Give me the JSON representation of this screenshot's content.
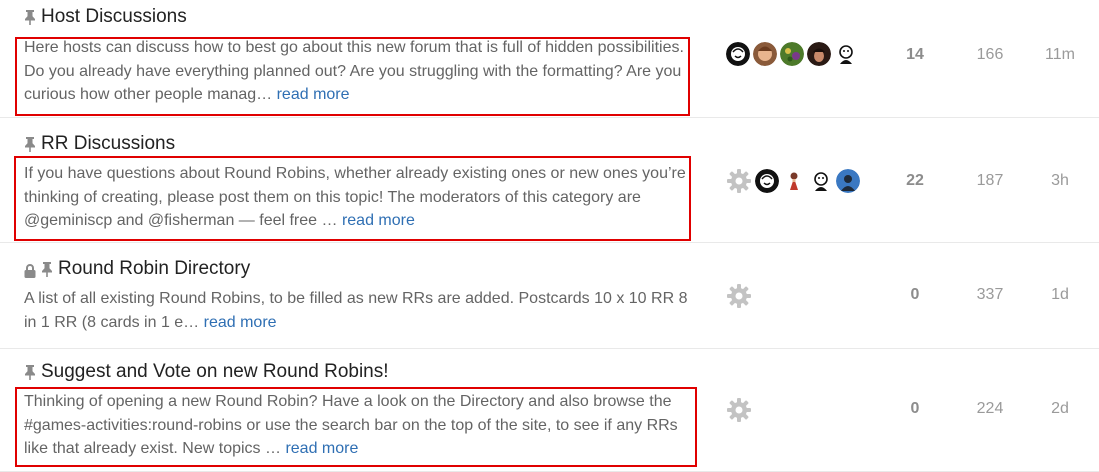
{
  "topics": [
    {
      "title": "Host Discussions",
      "excerpt": "Here hosts can discuss how to best go about this new forum that is full of hidden possibilities. Do you already have everything planned out? Are you struggling with the formatting? Are you curious how other people manag…",
      "read_more": "read more",
      "posters": [
        "bw-sketch-avatar",
        "woman-photo-avatar",
        "garden-avatar",
        "dark-hair-avatar",
        "cartoon-avatar"
      ],
      "replies": "14",
      "views": "166",
      "activity": "11m",
      "pinned": true,
      "locked": false,
      "highlighted": true
    },
    {
      "title": "RR Discussions",
      "excerpt": "If you have questions about Round Robins, whether already existing ones or new ones you’re thinking of creating, please post them on this topic! The moderators of this category are @geminiscp and @fisherman — feel free …",
      "read_more": "read more",
      "posters": [
        "gear-avatar",
        "bw-sketch-avatar",
        "doll-avatar",
        "cartoon-avatar",
        "blue-photo-avatar"
      ],
      "replies": "22",
      "views": "187",
      "activity": "3h",
      "pinned": true,
      "locked": false,
      "highlighted": true
    },
    {
      "title": "Round Robin Directory",
      "excerpt": "A list of all existing Round Robins, to be filled as new RRs are added. Postcards 10 x 10 RR 8 in 1 RR (8 cards in 1 e…",
      "read_more": "read more",
      "posters": [
        "gear-avatar"
      ],
      "replies": "0",
      "views": "337",
      "activity": "1d",
      "pinned": true,
      "locked": true,
      "highlighted": false
    },
    {
      "title": "Suggest and Vote on new Round Robins!",
      "excerpt": "Thinking of opening a new Round Robin? Have a look on the Directory and also browse the #games-activities:round-robins or use the search bar on the top of the site, to see if any RRs like that already exist. New topics …",
      "read_more": "read more",
      "posters": [
        "gear-avatar"
      ],
      "replies": "0",
      "views": "224",
      "activity": "2d",
      "pinned": true,
      "locked": false,
      "highlighted": true
    }
  ],
  "colors": {
    "highlight": "#e00000",
    "link": "#2f6fb3",
    "excerpt": "#646464"
  }
}
